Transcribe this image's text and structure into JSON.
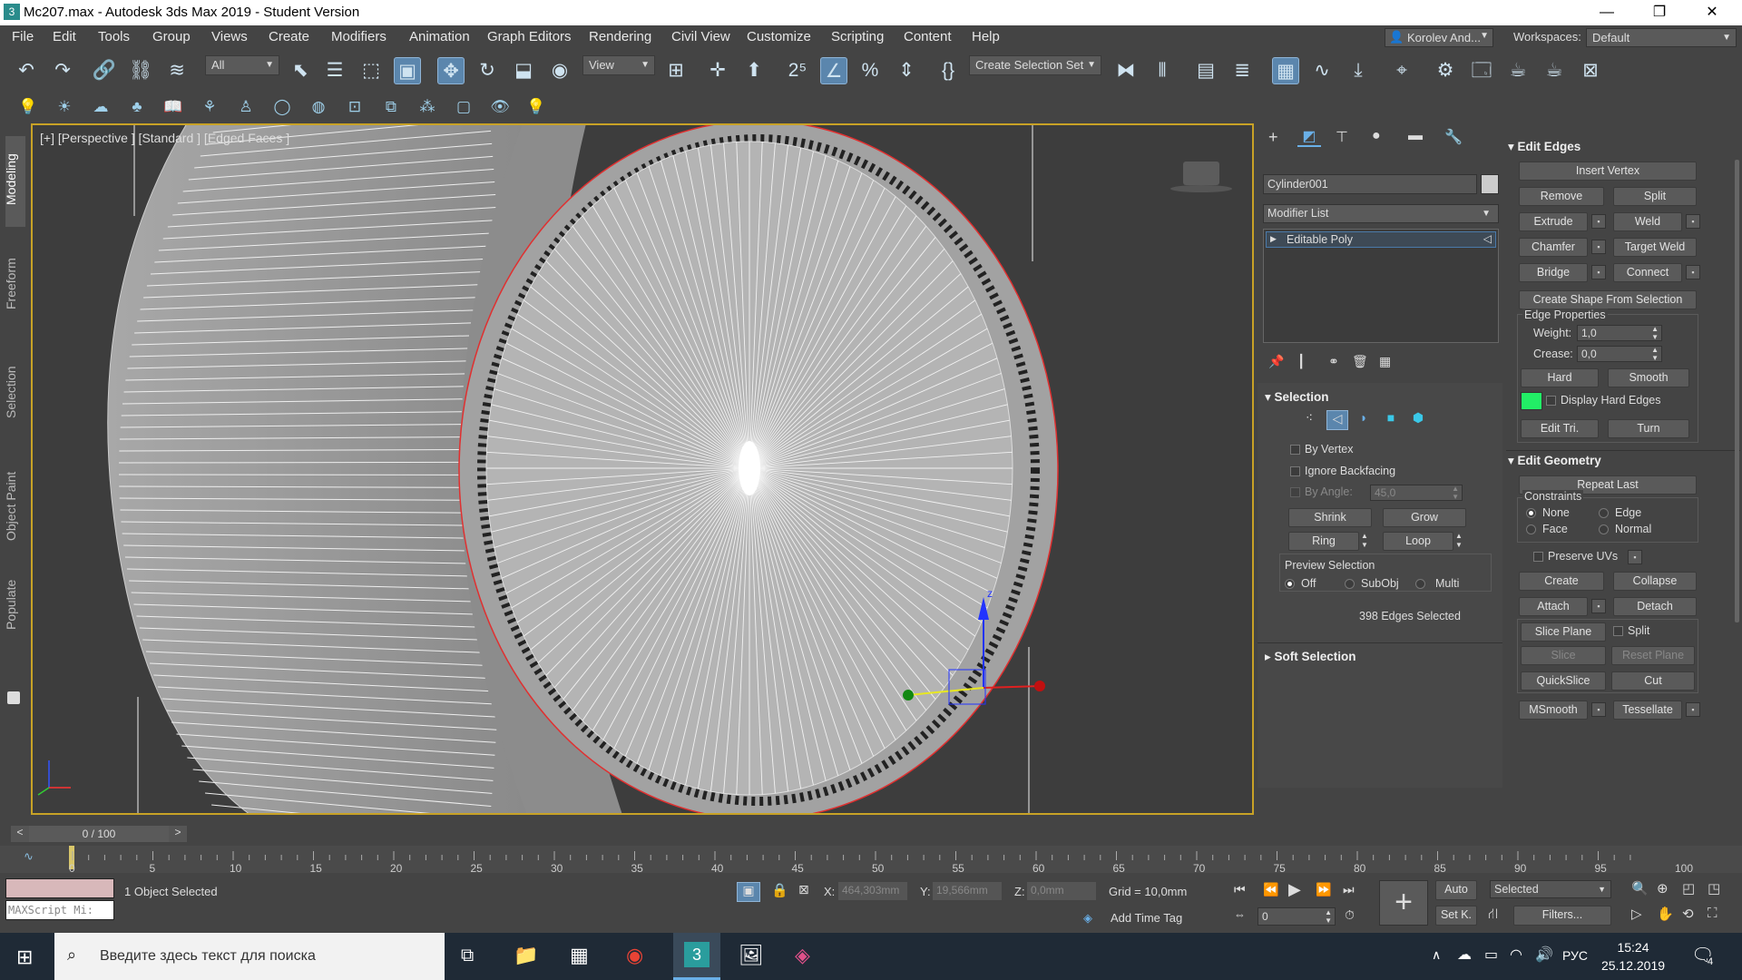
{
  "window": {
    "title": "Mc207.max - Autodesk 3ds Max 2019 - Student Version",
    "minimize": "—",
    "maximize": "❐",
    "close": "✕"
  },
  "menu": [
    "File",
    "Edit",
    "Tools",
    "Group",
    "Views",
    "Create",
    "Modifiers",
    "Animation",
    "Graph Editors",
    "Rendering",
    "Civil View",
    "Customize",
    "Scripting",
    "Content",
    "Help"
  ],
  "account": {
    "user": "Korolev And...",
    "workspaces_label": "Workspaces:",
    "workspace": "Default"
  },
  "toolbar": {
    "filter_select": "All",
    "view_select": "View",
    "create_selection_set": "Create Selection Set"
  },
  "left_tabs": [
    "Modeling",
    "Freeform",
    "Selection",
    "Object Paint",
    "Populate"
  ],
  "viewport": {
    "label": "[+] [Perspective ] [Standard ] [Edged Faces ]"
  },
  "command_panel": {
    "object_name": "Cylinder001",
    "modifier_list": "Modifier List",
    "stack_item": "Editable Poly",
    "selection": {
      "title": "Selection",
      "by_vertex": "By Vertex",
      "ignore_backfacing": "Ignore Backfacing",
      "by_angle": "By Angle:",
      "by_angle_value": "45,0",
      "shrink": "Shrink",
      "grow": "Grow",
      "ring": "Ring",
      "loop": "Loop",
      "preview_selection": "Preview Selection",
      "preview_off": "Off",
      "preview_subobj": "SubObj",
      "preview_multi": "Multi",
      "status": "398 Edges Selected"
    },
    "soft_selection": "Soft Selection",
    "edit_edges": {
      "title": "Edit Edges",
      "insert_vertex": "Insert Vertex",
      "remove": "Remove",
      "split": "Split",
      "extrude": "Extrude",
      "weld": "Weld",
      "chamfer": "Chamfer",
      "target_weld": "Target Weld",
      "bridge": "Bridge",
      "connect": "Connect",
      "create_shape": "Create Shape From Selection",
      "edge_properties": "Edge Properties",
      "weight_label": "Weight:",
      "weight_value": "1,0",
      "crease_label": "Crease:",
      "crease_value": "0,0",
      "hard": "Hard",
      "smooth": "Smooth",
      "display_hard_edges": "Display Hard Edges",
      "edit_tri": "Edit Tri.",
      "turn": "Turn"
    },
    "edit_geometry": {
      "title": "Edit Geometry",
      "repeat_last": "Repeat Last",
      "constraints": "Constraints",
      "none": "None",
      "edge": "Edge",
      "face": "Face",
      "normal": "Normal",
      "preserve_uvs": "Preserve UVs",
      "create": "Create",
      "collapse": "Collapse",
      "attach": "Attach",
      "detach": "Detach",
      "slice_plane": "Slice Plane",
      "split": "Split",
      "slice": "Slice",
      "reset_plane": "Reset Plane",
      "quickslice": "QuickSlice",
      "cut": "Cut",
      "msmooth": "MSmooth",
      "tessellate": "Tessellate"
    }
  },
  "timeline": {
    "frame": "0 / 100",
    "prev": "<",
    "next": ">",
    "ticks": [
      "0",
      "5",
      "10",
      "15",
      "20",
      "25",
      "30",
      "35",
      "40",
      "45",
      "50",
      "55",
      "60",
      "65",
      "70",
      "75",
      "80",
      "85",
      "90",
      "95",
      "100"
    ]
  },
  "status": {
    "maxscript": "MAXScript Mi:",
    "selected": "1 Object Selected",
    "x_label": "X:",
    "x_value": "464,303mm",
    "y_label": "Y:",
    "y_value": "19,566mm",
    "z_label": "Z:",
    "z_value": "0,0mm",
    "grid": "Grid = 10,0mm",
    "add_time_tag": "Add Time Tag",
    "auto": "Auto",
    "setk": "Set K.",
    "key_filter": "Selected",
    "filters": "Filters...",
    "frame_field": "0"
  },
  "taskbar": {
    "search_placeholder": "Введите здесь текст для поиска",
    "lang": "РУС",
    "time": "15:24",
    "date": "25.12.2019",
    "notif": "4"
  },
  "colors": {
    "accent": "#5b86ad",
    "viewport_border": "#c8a226",
    "hard_edge_swatch": "#22ee66",
    "selected_edge": "#e03030"
  }
}
